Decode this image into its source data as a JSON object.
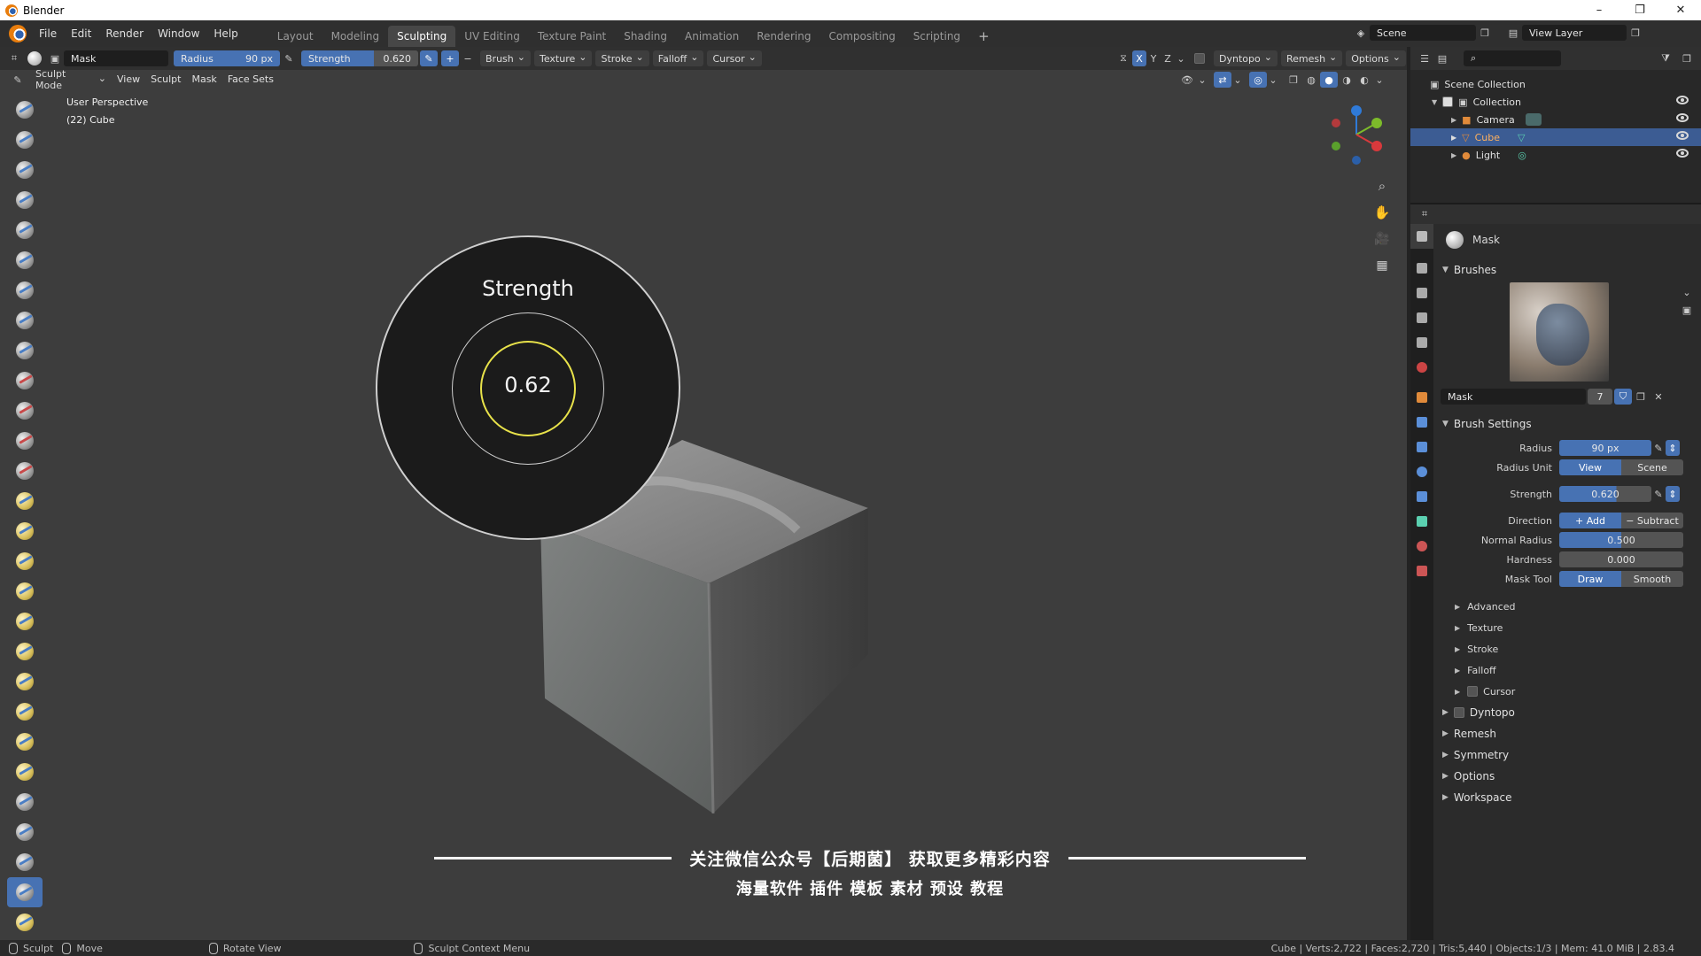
{
  "window": {
    "title": "Blender",
    "controls": [
      "–",
      "❐",
      "✕"
    ]
  },
  "menu": [
    "File",
    "Edit",
    "Render",
    "Window",
    "Help"
  ],
  "workspaces": [
    {
      "label": "Layout",
      "active": false
    },
    {
      "label": "Modeling",
      "active": false
    },
    {
      "label": "Sculpting",
      "active": true
    },
    {
      "label": "UV Editing",
      "active": false
    },
    {
      "label": "Texture Paint",
      "active": false
    },
    {
      "label": "Shading",
      "active": false
    },
    {
      "label": "Animation",
      "active": false
    },
    {
      "label": "Rendering",
      "active": false
    },
    {
      "label": "Compositing",
      "active": false
    },
    {
      "label": "Scripting",
      "active": false
    }
  ],
  "scene": {
    "name": "Scene",
    "view_layer": "View Layer"
  },
  "tool_header": {
    "brush_name": "Mask",
    "radius_label": "Radius",
    "radius_value": "90 px",
    "strength_label": "Strength",
    "strength_value": "0.620",
    "menus": [
      "Brush",
      "Texture",
      "Stroke",
      "Falloff",
      "Cursor"
    ],
    "axes": [
      "X",
      "Y",
      "Z"
    ],
    "dyntopo": "Dyntopo",
    "remesh": "Remesh",
    "options": "Options"
  },
  "mode_row": {
    "mode": "Sculpt Mode",
    "items": [
      "View",
      "Sculpt",
      "Mask",
      "Face Sets"
    ]
  },
  "viewport": {
    "perspective": "User Perspective",
    "object_info": "(22) Cube",
    "strength_popup_title": "Strength",
    "strength_popup_value": "0.62"
  },
  "promo": {
    "line1": "关注微信公众号【后期菌】 获取更多精彩内容",
    "line2": "海量软件 插件 模板 素材 预设 教程"
  },
  "outliner": {
    "root": "Scene Collection",
    "collection": "Collection",
    "items": [
      {
        "name": "Camera",
        "selected": false,
        "color": "#e08a3a"
      },
      {
        "name": "Cube",
        "selected": true,
        "color": "#e08a3a"
      },
      {
        "name": "Light",
        "selected": false,
        "color": "#e08a3a"
      }
    ]
  },
  "properties": {
    "brush_name": "Mask",
    "brushes_label": "Brushes",
    "brush_field": "Mask",
    "brush_users": "7",
    "brush_settings_label": "Brush Settings",
    "radius_label": "Radius",
    "radius_value": "90 px",
    "radius_unit_label": "Radius Unit",
    "radius_unit_options": [
      "View",
      "Scene"
    ],
    "strength_label": "Strength",
    "strength_value": "0.620",
    "direction_label": "Direction",
    "direction_options": [
      "+ Add",
      "− Subtract"
    ],
    "normal_radius_label": "Normal Radius",
    "normal_radius_value": "0.500",
    "hardness_label": "Hardness",
    "hardness_value": "0.000",
    "mask_tool_label": "Mask Tool",
    "mask_tool_options": [
      "Draw",
      "Smooth"
    ],
    "subsections": [
      "Advanced",
      "Texture",
      "Stroke",
      "Falloff",
      "Cursor"
    ],
    "panels": [
      "Dyntopo",
      "Remesh",
      "Symmetry",
      "Options",
      "Workspace"
    ]
  },
  "statusbar": {
    "left": [
      "Sculpt",
      "Move",
      "Rotate View",
      "Sculpt Context Menu"
    ],
    "right": "Cube | Verts:2,722 | Faces:2,720 | Tris:5,440 | Objects:1/3 | Mem: 41.0 MiB | 2.83.4"
  },
  "colors": {
    "accent": "#4772b3",
    "selection": "#3c5c93",
    "strength_ring": "#e8e24a"
  }
}
